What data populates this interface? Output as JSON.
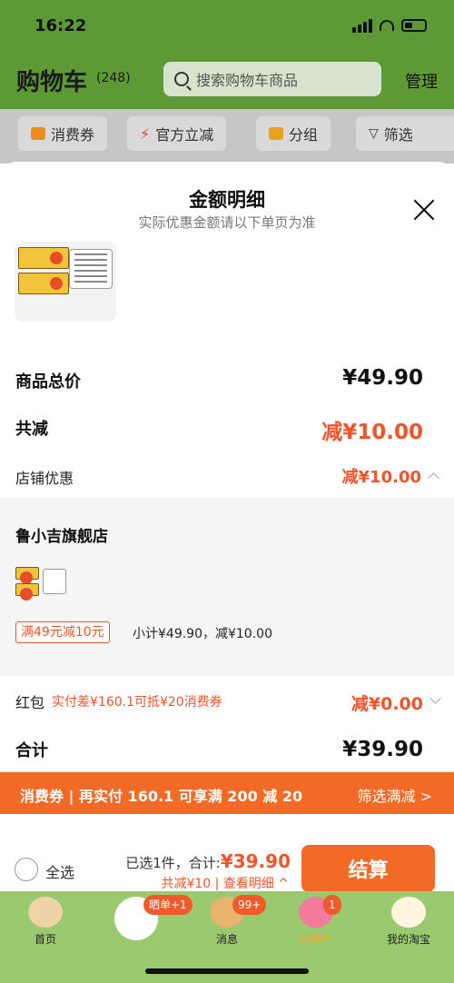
{
  "status": {
    "time": "16:22"
  },
  "header": {
    "title": "购物车",
    "count": "(248)",
    "search_placeholder": "搜索购物车商品",
    "manage": "管理"
  },
  "chips": [
    {
      "label": "消费券",
      "icon": "ticket-icon"
    },
    {
      "label": "官方立减",
      "icon": "lightning-icon"
    },
    {
      "label": "分组",
      "icon": "folder-icon"
    },
    {
      "label": "筛选",
      "icon": "filter-icon"
    }
  ],
  "sheet": {
    "title": "金额明细",
    "subtitle": "实际优惠金额请以下单页为准",
    "total_label": "商品总价",
    "total_value": "¥49.90",
    "reduce_label": "共减",
    "reduce_value": "减¥10.00",
    "shop_discount_label": "店铺优惠",
    "shop_discount_value": "减¥10.00",
    "shop_name": "鲁小吉旗舰店",
    "promo_tag": "满49元减10元",
    "promo_sub": "小计¥49.90，减¥10.00",
    "hongbao_label": "红包",
    "hongbao_note": "实付差¥160.1可抵¥20消费券",
    "hongbao_value": "减¥0.00",
    "sum_label": "合计",
    "sum_value": "¥39.90"
  },
  "banner": {
    "left": "消费券 | 再实付 160.1 可享满 200 减 20",
    "right": "筛选满减 >"
  },
  "checkout": {
    "select_all": "全选",
    "selected_prefix": "已选1件，合计:",
    "amount": "¥39.90",
    "discount": "共减¥10 | 查看明细 ^",
    "button": "结算"
  },
  "tabs": [
    {
      "label": "首页",
      "badge": ""
    },
    {
      "label": "",
      "badge": "晒单+1"
    },
    {
      "label": "消息",
      "badge": "99+"
    },
    {
      "label": "购物车",
      "badge": "1"
    },
    {
      "label": "我的淘宝",
      "badge": ""
    }
  ],
  "colors": {
    "accent": "#f26a26",
    "discount_red": "#f0552a",
    "header_green": "#5d9a36",
    "tabbar_green": "#9ac970"
  }
}
